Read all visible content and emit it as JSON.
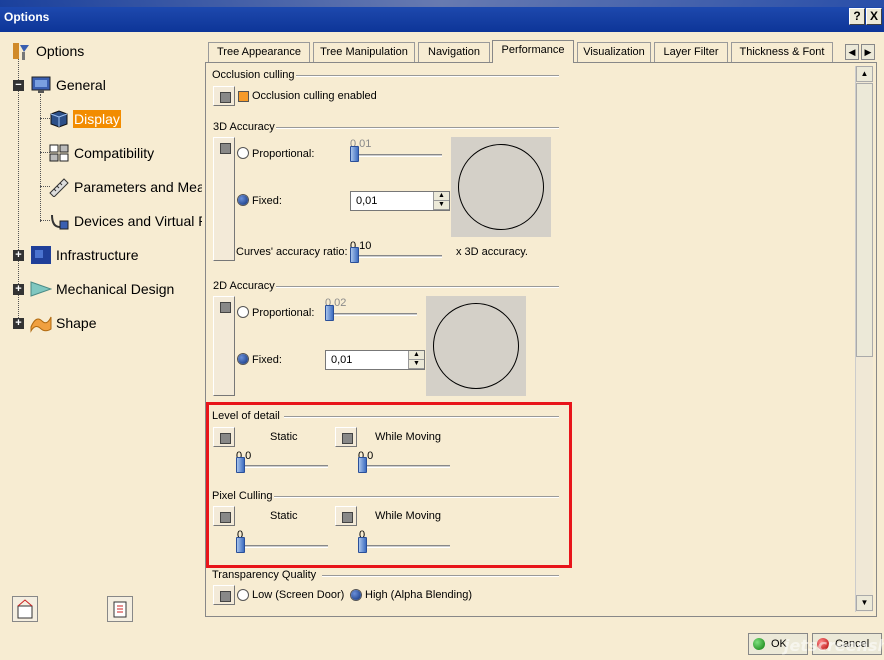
{
  "window": {
    "title": "Options",
    "help_label": "?",
    "close_label": "X"
  },
  "tree": {
    "root": "Options",
    "items": [
      {
        "label": "General"
      },
      {
        "label": "Display"
      },
      {
        "label": "Compatibility"
      },
      {
        "label": "Parameters and Meas"
      },
      {
        "label": "Devices and Virtual R"
      },
      {
        "label": "Infrastructure"
      },
      {
        "label": "Mechanical Design"
      },
      {
        "label": "Shape"
      }
    ]
  },
  "tabs": [
    {
      "label": "Tree Appearance"
    },
    {
      "label": "Tree Manipulation"
    },
    {
      "label": "Navigation"
    },
    {
      "label": "Performance"
    },
    {
      "label": "Visualization"
    },
    {
      "label": "Layer Filter"
    },
    {
      "label": "Thickness & Font"
    }
  ],
  "tab_arrows": {
    "left": "◀",
    "right": "▶"
  },
  "scrollbar": {
    "up": "▲",
    "down": "▼"
  },
  "occlusion": {
    "title": "Occlusion culling",
    "checkbox_label": "Occlusion culling enabled"
  },
  "accuracy3d": {
    "title": "3D Accuracy",
    "proportional_label": "Proportional:",
    "proportional_value": "0.01",
    "fixed_label": "Fixed:",
    "fixed_value": "0,01",
    "curves_label": "Curves' accuracy ratio:",
    "curves_value": "0.10",
    "curves_suffix": "x 3D accuracy."
  },
  "accuracy2d": {
    "title": "2D Accuracy",
    "proportional_label": "Proportional:",
    "proportional_value": "0.02",
    "fixed_label": "Fixed:",
    "fixed_value": "0,01"
  },
  "level_of_detail": {
    "title": "Level of detail",
    "static_label": "Static",
    "static_value": "0.0",
    "moving_label": "While Moving",
    "moving_value": "0.0"
  },
  "pixel_culling": {
    "title": "Pixel Culling",
    "static_label": "Static",
    "static_value": "0",
    "moving_label": "While Moving",
    "moving_value": "0"
  },
  "transparency": {
    "title": "Transparency Quality",
    "low_label": "Low (Screen Door)",
    "high_label": "High (Alpha Blending)"
  },
  "footer": {
    "ok_label": "OK",
    "cancel_label": "Cancel"
  },
  "watermark": "jetscreenshot"
}
